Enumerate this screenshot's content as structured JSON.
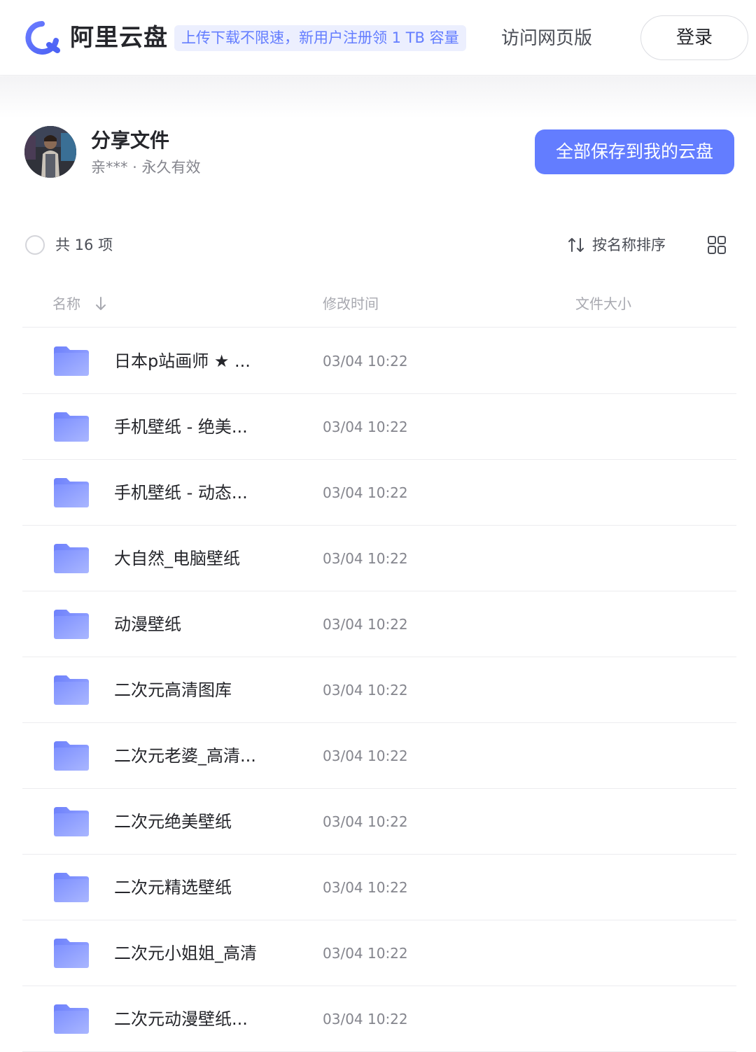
{
  "header": {
    "brand": "阿里云盘",
    "promo": "上传下载不限速，新用户注册领 1 TB 容量",
    "web_link": "访问网页版",
    "login": "登录"
  },
  "share": {
    "title": "分享文件",
    "meta": "亲*** · 永久有效",
    "save_all": "全部保存到我的云盘"
  },
  "toolbar": {
    "count": "共 16 项",
    "sort_label": "按名称排序"
  },
  "columns": {
    "name": "名称",
    "modified": "修改时间",
    "size": "文件大小"
  },
  "files": [
    {
      "name": "日本p站画师 ★ ...",
      "time": "03/04 10:22"
    },
    {
      "name": "手机壁纸 - 绝美...",
      "time": "03/04 10:22"
    },
    {
      "name": "手机壁纸 - 动态...",
      "time": "03/04 10:22"
    },
    {
      "name": "大自然_电脑壁纸",
      "time": "03/04 10:22"
    },
    {
      "name": "动漫壁纸",
      "time": "03/04 10:22"
    },
    {
      "name": "二次元高清图库",
      "time": "03/04 10:22"
    },
    {
      "name": "二次元老婆_高清...",
      "time": "03/04 10:22"
    },
    {
      "name": "二次元绝美壁纸",
      "time": "03/04 10:22"
    },
    {
      "name": "二次元精选壁纸",
      "time": "03/04 10:22"
    },
    {
      "name": "二次元小姐姐_高清",
      "time": "03/04 10:22"
    },
    {
      "name": "二次元动漫壁纸...",
      "time": "03/04 10:22"
    }
  ],
  "colors": {
    "accent": "#637dff",
    "promo_bg": "#eceffe",
    "text_primary": "#25262b",
    "text_secondary": "#84858d"
  },
  "icons": {
    "logo": "aliyun-drive-logo",
    "sort": "sort-arrows-icon",
    "grid": "grid-view-icon",
    "folder": "folder-icon",
    "sort_direction": "arrow-down-icon"
  }
}
